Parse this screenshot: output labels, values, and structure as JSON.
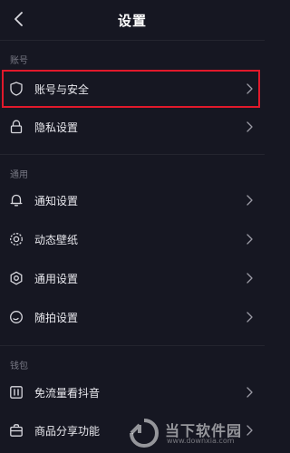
{
  "header": {
    "title": "设置"
  },
  "sections": [
    {
      "label": "账号"
    },
    {
      "label": "通用"
    },
    {
      "label": "钱包"
    }
  ],
  "rows": [
    {
      "label": "账号与安全",
      "icon": "shield-icon"
    },
    {
      "label": "隐私设置",
      "icon": "lock-icon"
    },
    {
      "label": "通知设置",
      "icon": "bell-icon"
    },
    {
      "label": "动态壁纸",
      "icon": "wallpaper-icon"
    },
    {
      "label": "通用设置",
      "icon": "gear-icon"
    },
    {
      "label": "随拍设置",
      "icon": "capture-icon"
    },
    {
      "label": "免流量看抖音",
      "icon": "data-icon"
    },
    {
      "label": "商品分享功能",
      "icon": "shopping-bag-icon"
    }
  ],
  "watermark": {
    "title": "当下软件园",
    "url": "www.downxia.com"
  },
  "colors": {
    "background": "#161722",
    "highlight": "#e1192b",
    "divider": "#24252f"
  }
}
